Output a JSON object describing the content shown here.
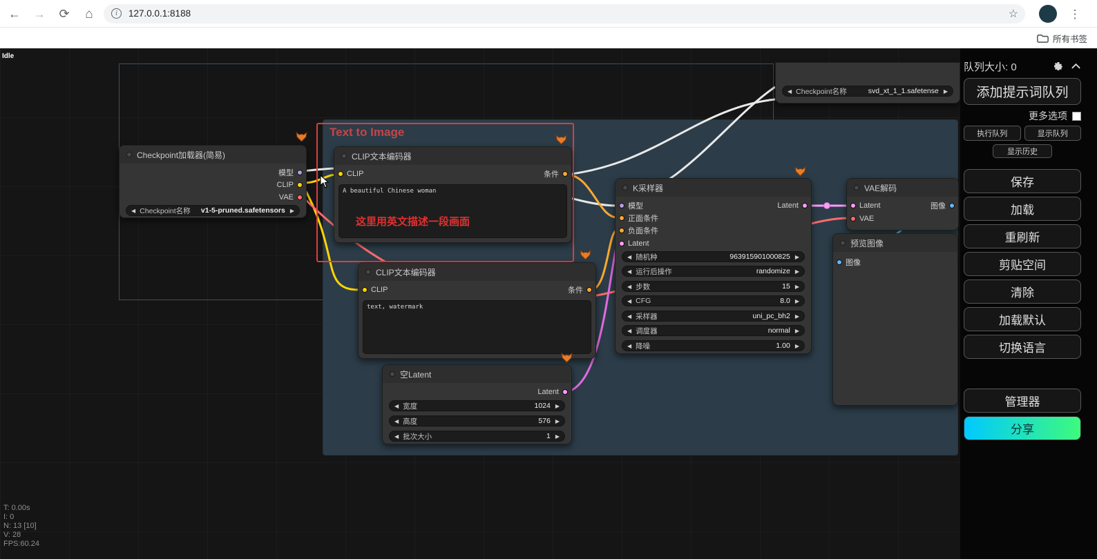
{
  "icons": {
    "back": "←",
    "forward": "→",
    "reload": "⟳",
    "home": "⌂",
    "star": "☆",
    "menu": "⋮",
    "info": "i",
    "left": "◀",
    "right": "▶"
  },
  "browser": {
    "url": "127.0.0.1:8188",
    "bookmarks_label": "所有书签"
  },
  "status": {
    "idle": "Idle",
    "stats": [
      "T: 0.00s",
      "I: 0",
      "N: 13 [10]",
      "V: 28",
      "FPS:60.24"
    ]
  },
  "canvas": {
    "group_title": "Text to Image",
    "annotation": "这里用英文描述一段画面"
  },
  "colors": {
    "highlight_red": "#e23b3b",
    "share_gradient_start": "#00c9ff",
    "share_gradient_end": "#3efa7d"
  },
  "nodes": {
    "checkpoint": {
      "title": "Checkpoint加载器(简易)",
      "outputs": [
        "模型",
        "CLIP",
        "VAE"
      ],
      "widget": {
        "label": "Checkpoint名称",
        "value": "v1-5-pruned.safetensors"
      }
    },
    "svd_partial": {
      "widget": {
        "label": "Checkpoint名称",
        "value": "svd_xt_1_1.safetense"
      }
    },
    "clip1": {
      "title": "CLIP文本编码器",
      "input": "CLIP",
      "output": "条件",
      "text": "A beautiful Chinese woman"
    },
    "clip2": {
      "title": "CLIP文本编码器",
      "input": "CLIP",
      "output": "条件",
      "text": "text, watermark"
    },
    "latent": {
      "title": "空Latent",
      "output": "Latent",
      "widgets": [
        {
          "label": "宽度",
          "value": "1024"
        },
        {
          "label": "高度",
          "value": "576"
        },
        {
          "label": "批次大小",
          "value": "1"
        }
      ]
    },
    "ksampler": {
      "title": "K采样器",
      "inputs": [
        "模型",
        "正面条件",
        "负面条件",
        "Latent"
      ],
      "output": "Latent",
      "widgets": [
        {
          "label": "随机种",
          "value": "963915901000825"
        },
        {
          "label": "运行后操作",
          "value": "randomize"
        },
        {
          "label": "步数",
          "value": "15"
        },
        {
          "label": "CFG",
          "value": "8.0"
        },
        {
          "label": "采样器",
          "value": "uni_pc_bh2"
        },
        {
          "label": "调度器",
          "value": "normal"
        },
        {
          "label": "降噪",
          "value": "1.00"
        }
      ]
    },
    "vae_decode": {
      "title": "VAE解码",
      "inputs": [
        "Latent",
        "VAE"
      ],
      "output": "图像"
    },
    "preview": {
      "title": "预览图像",
      "input": "图像"
    }
  },
  "sidebar": {
    "queue_size": "队列大小: 0",
    "queue_prompt": "添加提示词队列",
    "extra_options": "更多选项",
    "run_queue": "执行队列",
    "show_queue": "显示队列",
    "show_history": "显示历史",
    "buttons": [
      "保存",
      "加载",
      "重刷新",
      "剪贴空间",
      "清除",
      "加载默认",
      "切换语言"
    ],
    "manager": "管理器",
    "share": "分享"
  }
}
